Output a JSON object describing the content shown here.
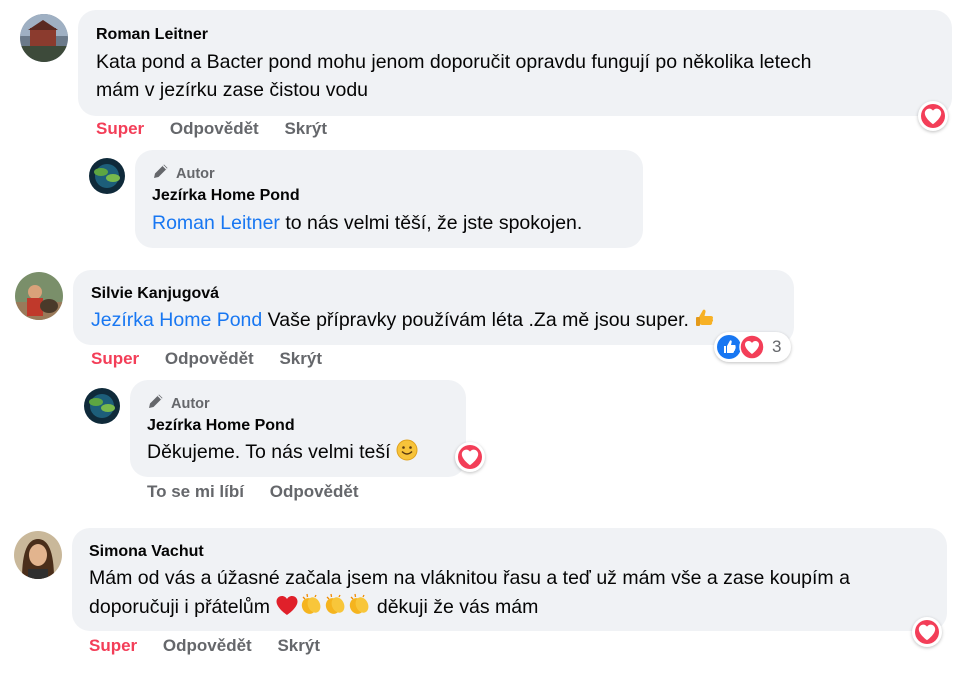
{
  "comments": [
    {
      "author": "Roman Leitner",
      "text": "Kata pond a Bacter pond mohu jenom doporučit opravdu fungují po několika letech mám v jezírku zase čistou vodu",
      "line1": "Kata pond a Bacter pond mohu jenom doporučit opravdu fungují po několika letech",
      "line2": "mám v jezírku zase čistou vodu",
      "actions": [
        "Super",
        "Odpovědět",
        "Skrýt"
      ],
      "reaction": "heart-icon",
      "reply": {
        "badge": "Autor",
        "author": "Jezírka Home Pond",
        "mention": "Roman Leitner",
        "text": " to nás velmi těší, že jste spokojen."
      }
    },
    {
      "author": "Silvie Kanjugová",
      "mention": "Jezírka Home Pond",
      "text": " Vaše přípravky používám léta .Za mě jsou super.",
      "emoji": "thumbs-up-icon",
      "actions": [
        "Super",
        "Odpovědět",
        "Skrýt"
      ],
      "reactions": [
        "like-icon",
        "heart-icon"
      ],
      "reaction_count": "3",
      "reply": {
        "badge": "Autor",
        "author": "Jezírka Home Pond",
        "text": "Děkujeme. To nás velmi teší",
        "emoji": "smiley-icon",
        "reaction": "heart-icon",
        "actions": [
          "To se mi líbí",
          "Odpovědět"
        ]
      }
    },
    {
      "author": "Simona Vachut",
      "line1": "Mám od vás a úžasné začala jsem na vláknitou řasu a teď už mám vše a zase koupím a",
      "line2a": "doporučuji i přátelům",
      "line2b": " děkuji že vás mám",
      "emojis": [
        "red-heart-icon",
        "clapping-hands-icon",
        "clapping-hands-icon",
        "clapping-hands-icon"
      ],
      "actions": [
        "Super",
        "Odpovědět",
        "Skrýt"
      ],
      "reaction": "heart-icon"
    }
  ],
  "colors": {
    "bubble": "#f0f2f5",
    "link": "#1877f2",
    "super": "#f33e58",
    "muted": "#65676b",
    "heart": "#f33e58"
  }
}
